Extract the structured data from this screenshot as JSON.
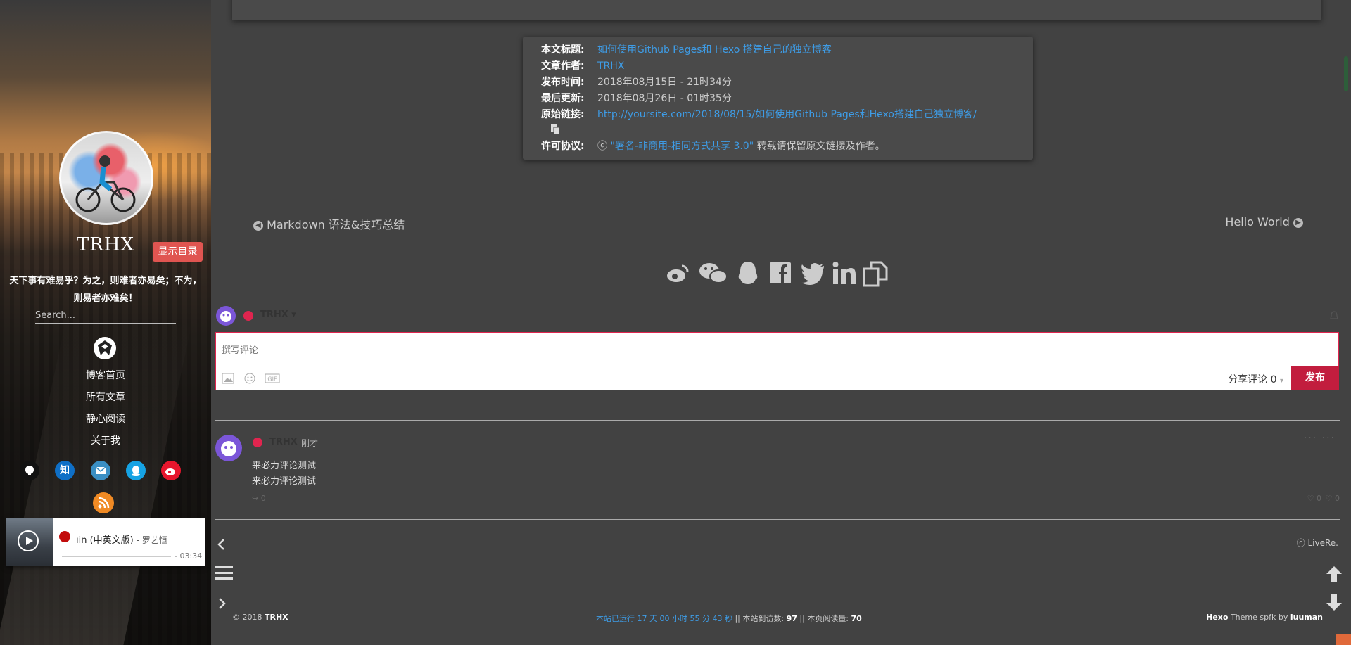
{
  "sidebar": {
    "site_title": "TRHX",
    "toc_button": "显示目录",
    "motto_line1": "天下事有难易乎？为之，则难者亦易矣；不为，",
    "motto_line2": "则易者亦难矣！",
    "search_placeholder": "Search...",
    "nav": [
      "博客首页",
      "所有文章",
      "静心阅读",
      "关于我"
    ],
    "social": [
      {
        "icon": "github-icon",
        "label": "",
        "color": "#111111"
      },
      {
        "icon": "zhihu-icon",
        "label": "知",
        "color": "#0f6fc6"
      },
      {
        "icon": "mail-icon",
        "label": "",
        "color": "#3a8fc4"
      },
      {
        "icon": "qq-icon",
        "label": "",
        "color": "#16a3e4"
      },
      {
        "icon": "weibo-icon",
        "label": "",
        "color": "#e6162d"
      }
    ],
    "rss_icon": "rss-icon",
    "player": {
      "song": "ıin (中英文版)",
      "artist": " - 罗艺恒",
      "time": "- 03:34"
    }
  },
  "article_info": {
    "rows": [
      {
        "key": "本文标题:",
        "value": "如何使用Github Pages和 Hexo 搭建自己的独立博客",
        "link": true
      },
      {
        "key": "文章作者:",
        "value": "TRHX",
        "link": true
      },
      {
        "key": "发布时间:",
        "value": "2018年08月15日 - 21时34分",
        "link": false
      },
      {
        "key": "最后更新:",
        "value": "2018年08月26日 - 01时35分",
        "link": false
      },
      {
        "key": "原始链接:",
        "value": "http://yoursite.com/2018/08/15/如何使用Github Pages和Hexo搭建自己独立博客/",
        "link": true
      }
    ],
    "license_key": "许可协议:",
    "license_cc": "ⓒ",
    "license_link": "\"署名-非商用-相同方式共享 3.0\"",
    "license_tail": " 转载请保留原文链接及作者。"
  },
  "post_nav": {
    "prev": "Markdown 语法&技巧总结",
    "next": "Hello World"
  },
  "comments": {
    "username": "TRHX",
    "placeholder": "撰写评论",
    "share_label": "分享评论 0",
    "submit": "发布",
    "item": {
      "user": "TRHX",
      "time": "刚才",
      "line1": "来必力评论测试",
      "line2": "来必力评论测试",
      "reply_count": "0",
      "like_count": "0",
      "dislike_count": "0"
    },
    "livere": "ⓒ LiveRe."
  },
  "footer": {
    "copyright_prefix": "© 2018 ",
    "owner": "TRHX",
    "running": "本站已运行 17 天 00 小时 55 分 43 秒",
    "sep1": " || ",
    "visits_label": "本站到访数: ",
    "visits": "97",
    "sep2": " || ",
    "reads_label": "本页阅读量: ",
    "reads": "70",
    "hexo": "Hexo",
    "theme": " Theme spfk by ",
    "author": "luuman"
  },
  "colors": {
    "background": "#424242",
    "accent_link": "#3e9ce6",
    "toc_button": "#e05551",
    "submit": "#c21d3e"
  }
}
